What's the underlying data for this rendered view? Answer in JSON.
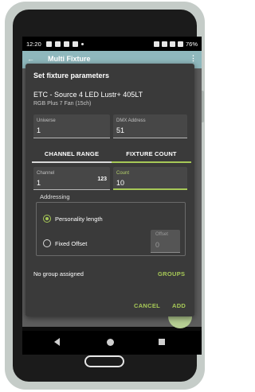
{
  "status_bar": {
    "time": "12:20",
    "battery": "76%"
  },
  "app_bar": {
    "back_icon": "←",
    "title": "Multi Fixture",
    "more_icon": "⋮"
  },
  "dialog": {
    "title": "Set fixture parameters",
    "fixture_name": "ETC - Source 4 LED Lustr+ 405LT",
    "fixture_mode": "RGB Plus 7 Fan (15ch)",
    "universe": {
      "label": "Universe",
      "value": "1"
    },
    "dmx_address": {
      "label": "DMX Address",
      "value": "51"
    },
    "tabs": [
      {
        "label": "CHANNEL RANGE",
        "selected": false
      },
      {
        "label": "FIXTURE COUNT",
        "selected": true
      }
    ],
    "channel": {
      "label": "Channel",
      "value": "1",
      "keypad_icon": "123"
    },
    "count": {
      "label": "Count",
      "value": "10"
    },
    "addressing": {
      "label": "Addressing",
      "options": [
        {
          "label": "Personality length",
          "checked": true
        },
        {
          "label": "Fixed Offset",
          "checked": false
        }
      ],
      "offset": {
        "label": "Offset",
        "value": "0"
      }
    },
    "group_text": "No group assigned",
    "groups_button": "GROUPS",
    "cancel_button": "CANCEL",
    "add_button": "ADD"
  },
  "colors": {
    "accent": "#a7c957",
    "dialog_bg": "#3a3a3a",
    "app_bar": "#8fb8bd"
  }
}
